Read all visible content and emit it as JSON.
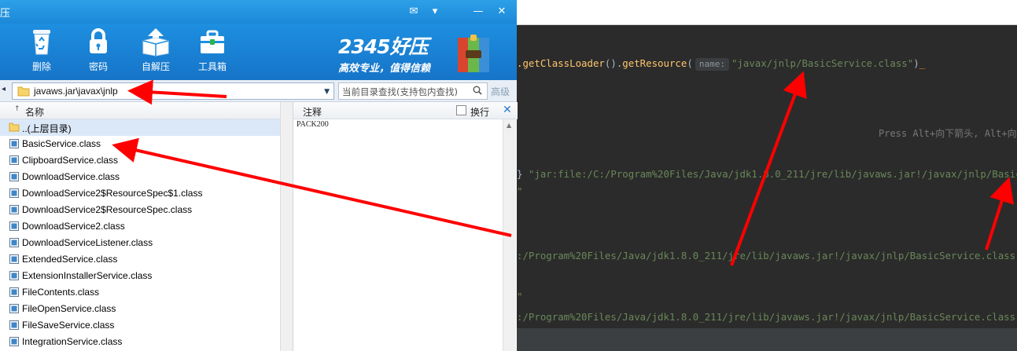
{
  "ide": {
    "line1": {
      "method_a": ".getClassLoader",
      "paren_a": "().",
      "method_b": "getResource",
      "paren_b": "(",
      "hint": "name:",
      "arg": "\"javax/jnlp/BasicService.class\"",
      "close": ")",
      "caret": "_"
    },
    "tip": "Press Alt+向下箭头, Alt+向",
    "line2_prefix": "} ",
    "line2": "\"jar:file:/C:/Program%20Files/Java/jdk1.8.0_211/jre/lib/javaws.jar!/javax/jnlp/BasicServi",
    "line2_tail": "\"",
    "line3": ":/Program%20Files/Java/jdk1.8.0_211/jre/lib/javaws.jar!/javax/jnlp/BasicService.class\"",
    "line3_lead": "\"",
    "line4": ":/Program%20Files/Java/jdk1.8.0_211/jre/lib/javaws.jar!/javax/jnlp/BasicService.class\"",
    "line4_lead": "\""
  },
  "app": {
    "title_char": "压",
    "window_buttons": {
      "skin": "✉",
      "menu": "▾",
      "minimize": "—",
      "close": "✕"
    },
    "toolbar": {
      "delete_label": "删除",
      "password_label": "密码",
      "selfextract_label": "自解压",
      "toolbox_label": "工具箱"
    },
    "brand": {
      "title": "2345好压",
      "slogan": "高效专业，值得信赖"
    },
    "address": {
      "back": "◂",
      "path": "javaws.jar\\javax\\jnlp",
      "dropdown": "▼",
      "search_placeholder": "当前目录查找(支持包内查找)",
      "advanced": "高级"
    },
    "filelist": {
      "sort_indicator": "↑",
      "column_name": "名称",
      "items": [
        {
          "name": "..(上层目录)",
          "type": "folder"
        },
        {
          "name": "BasicService.class",
          "type": "file"
        },
        {
          "name": "ClipboardService.class",
          "type": "file"
        },
        {
          "name": "DownloadService.class",
          "type": "file"
        },
        {
          "name": "DownloadService2$ResourceSpec$1.class",
          "type": "file"
        },
        {
          "name": "DownloadService2$ResourceSpec.class",
          "type": "file"
        },
        {
          "name": "DownloadService2.class",
          "type": "file"
        },
        {
          "name": "DownloadServiceListener.class",
          "type": "file"
        },
        {
          "name": "ExtendedService.class",
          "type": "file"
        },
        {
          "name": "ExtensionInstallerService.class",
          "type": "file"
        },
        {
          "name": "FileContents.class",
          "type": "file"
        },
        {
          "name": "FileOpenService.class",
          "type": "file"
        },
        {
          "name": "FileSaveService.class",
          "type": "file"
        },
        {
          "name": "IntegrationService.class",
          "type": "file"
        }
      ]
    },
    "notes": {
      "title": "注释",
      "wrap_label": "换行",
      "close": "✕",
      "content": "PACK200",
      "scroll_up": "▲"
    }
  },
  "colors": {
    "toolbar_blue": "#1e8fe0",
    "ide_background": "#2b2b2b",
    "annotation_red": "#ff0000",
    "string_green": "#6a8759",
    "method_yellow": "#ffc66d"
  }
}
